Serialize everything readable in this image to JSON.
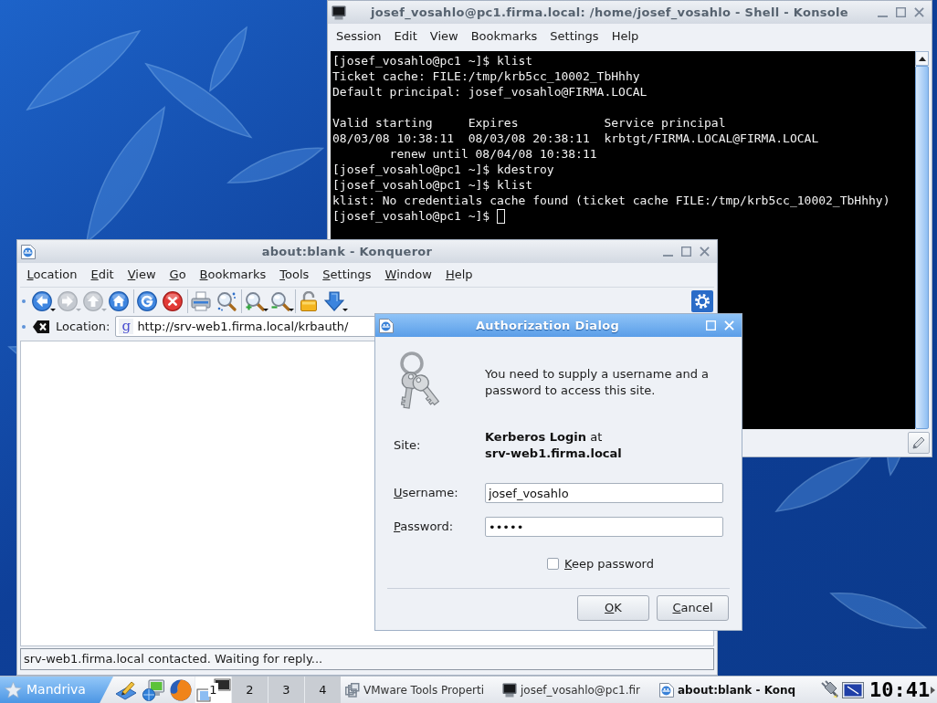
{
  "konsole": {
    "active": false,
    "title": "josef_vosahlo@pc1.firma.local: /home/josef_vosahlo - Shell - Konsole",
    "menu": [
      "Session",
      "Edit",
      "View",
      "Bookmarks",
      "Settings",
      "Help"
    ],
    "terminal": {
      "blocks": [
        [
          "[josef_vosahlo@pc1 ~]$ klist",
          "Ticket cache: FILE:/tmp/krb5cc_10002_TbHhhy",
          "Default principal: josef_vosahlo@FIRMA.LOCAL"
        ],
        [
          "Valid starting     Expires            Service principal",
          "08/03/08 10:38:11  08/03/08 20:38:11  krbtgt/FIRMA.LOCAL@FIRMA.LOCAL",
          "        renew until 08/04/08 10:38:11",
          "[josef_vosahlo@pc1 ~]$ kdestroy",
          "[josef_vosahlo@pc1 ~]$ klist",
          "klist: No credentials cache found (ticket cache FILE:/tmp/krb5cc_10002_TbHhhy)",
          "[josef_vosahlo@pc1 ~]$"
        ]
      ],
      "cursor": true
    }
  },
  "konqueror": {
    "active": false,
    "title": "about:blank - Konqueror",
    "menu": [
      "Location",
      "Edit",
      "View",
      "Go",
      "Bookmarks",
      "Tools",
      "Settings",
      "Window",
      "Help"
    ],
    "toolbar_groups": [
      [
        {
          "kind": "back",
          "disabled": false
        },
        {
          "kind": "forward",
          "disabled": true
        },
        {
          "kind": "up",
          "disabled": true
        },
        {
          "kind": "home",
          "disabled": false
        }
      ],
      [
        {
          "kind": "reload",
          "disabled": false
        },
        {
          "kind": "stop",
          "disabled": false
        }
      ],
      [
        {
          "kind": "print",
          "disabled": false
        },
        {
          "kind": "find",
          "disabled": false
        }
      ],
      [
        {
          "kind": "zoom_in",
          "disabled": false
        },
        {
          "kind": "zoom_out",
          "disabled": false
        }
      ],
      [
        {
          "kind": "security",
          "disabled": false
        },
        {
          "kind": "download",
          "disabled": false
        }
      ]
    ],
    "location": {
      "label": "Location:",
      "shortcut": "g",
      "url": "http://srv-web1.firma.local/krbauth/"
    },
    "status": "srv-web1.firma.local contacted. Waiting for reply..."
  },
  "dialog": {
    "active": true,
    "title": "Authorization Dialog",
    "message": "You need to supply a username and a password to access this site.",
    "site_label": "Site:",
    "site": "**Kerberos Login** at\n**srv-web1.firma.local**",
    "fields": [
      {
        "label": "Username:",
        "value": "josef_vosahlo"
      },
      {
        "label": "Password:",
        "value": "•••••"
      }
    ],
    "keep_password": {
      "label": "Keep password",
      "checked": false
    },
    "buttons": [
      "OK",
      "Cancel"
    ]
  },
  "taskbar": {
    "start": "Mandriva",
    "desktops": [
      {
        "label": "1",
        "selected": true
      },
      {
        "label": "2",
        "selected": false
      },
      {
        "label": "3",
        "selected": false
      },
      {
        "label": "4",
        "selected": false
      }
    ],
    "tasks": [
      {
        "kind": "vmware",
        "label": "VMware Tools Properti",
        "selected": false
      },
      {
        "kind": "terminal",
        "label": "josef_vosahlo@pc1.fir",
        "selected": false
      },
      {
        "kind": "browser",
        "label": "about:blank - Konq",
        "selected": true
      }
    ],
    "clock": "10:41"
  }
}
